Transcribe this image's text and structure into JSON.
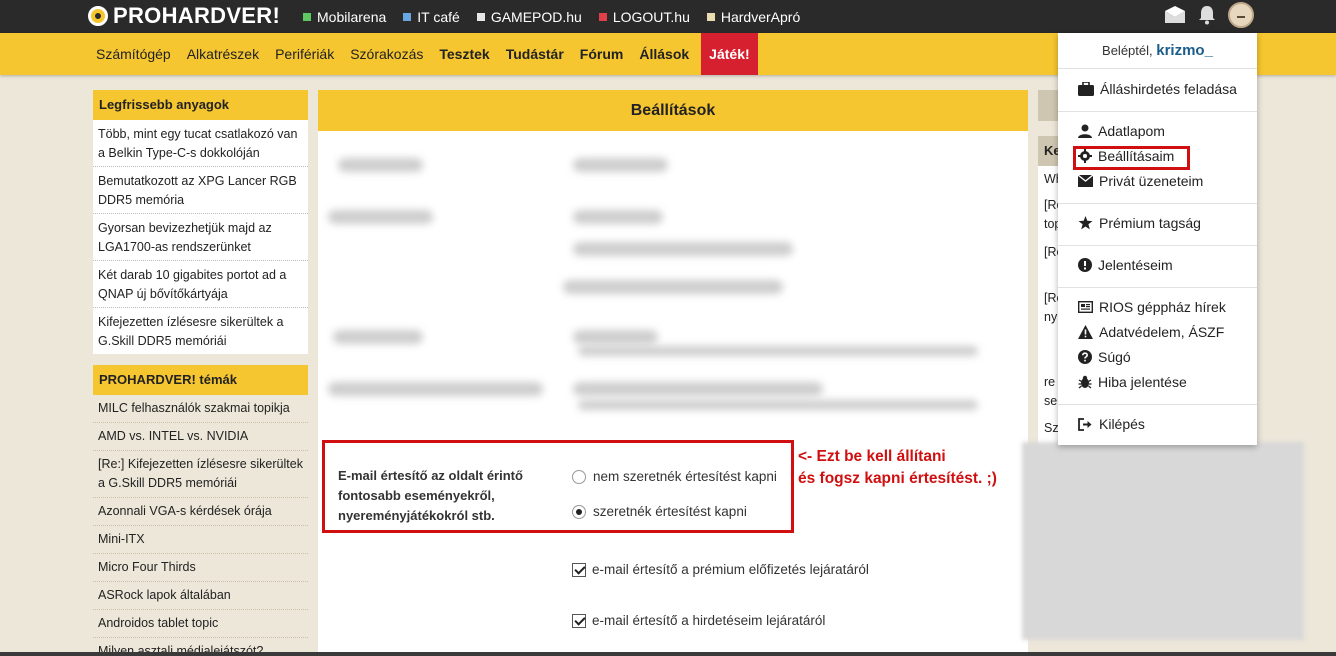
{
  "logo": {
    "text": "PROHARDVER!"
  },
  "sites": [
    {
      "label": "Mobilarena",
      "color": "#5fc75f"
    },
    {
      "label": "IT café",
      "color": "#6aa7e0"
    },
    {
      "label": "GAMEPOD.hu",
      "color": "#e6e6e6"
    },
    {
      "label": "LOGOUT.hu",
      "color": "#e0404a"
    },
    {
      "label": "HardverApró",
      "color": "#e8dcb0"
    }
  ],
  "nav": [
    {
      "label": "Számítógép"
    },
    {
      "label": "Alkatrészek"
    },
    {
      "label": "Perifériák"
    },
    {
      "label": "Szórakozás"
    },
    {
      "label": "Tesztek"
    },
    {
      "label": "Tudástár"
    },
    {
      "label": "Fórum"
    },
    {
      "label": "Állások"
    },
    {
      "label": "Játék!"
    }
  ],
  "latest": {
    "title": "Legfrissebb anyagok",
    "items": [
      "Több, mint egy tucat csatlakozó van a Belkin Type-C-s dokkolóján",
      "Bemutatkozott az XPG Lancer RGB DDR5 memória",
      "Gyorsan bevizezhetjük majd az LGA1700-as rendszerünket",
      "Két darab 10 gigabites portot ad a QNAP új bővítőkártyája",
      "Kifejezetten ízlésesre sikerültek a G.Skill DDR5 memóriái"
    ]
  },
  "topics": {
    "title": "PROHARDVER! témák",
    "items": [
      "MILC felhasználók szakmai topikja",
      "AMD vs. INTEL vs. NVIDIA",
      "[Re:] Kifejezetten ízlésesre sikerültek a G.Skill DDR5 memóriái",
      "Azonnali VGA-s kérdések órája",
      "Mini-ITX",
      "Micro Four Thirds",
      "ASRock lapok általában",
      "Androidos tablet topic",
      "Milyen asztali médialejátszót?"
    ]
  },
  "settings": {
    "title": "Beállítások",
    "email_label": "E-mail értesítő az oldalt érintő fontosabb eseményekről, nyereményjátékokról stb.",
    "radio_no": "nem szeretnék értesítést kapni",
    "radio_yes": "szeretnék értesítést kapni",
    "check_premium": "e-mail értesítő a prémium előfizetés lejáratáról",
    "check_ads": "e-mail értesítő a hirdetéseim lejáratáról"
  },
  "annotation": {
    "line1": "<- Ezt be kell állítani",
    "line2": "és fogsz kapni értesítést. ;)"
  },
  "right": {
    "head": "Ke",
    "lines": [
      "Wh",
      "[Re",
      "top",
      "[Re",
      "[Re",
      "ny",
      "re",
      "se",
      "se",
      "Sz"
    ]
  },
  "dropdown": {
    "logged_prefix": "Beléptél,",
    "username": "krizmo_",
    "items": {
      "jobpost": "Álláshirdetés feladása",
      "profile": "Adatlapom",
      "settings": "Beállításaim",
      "messages": "Privát üzeneteim",
      "premium": "Prémium tagság",
      "reports": "Jelentéseim",
      "rios": "RIOS géppház hírek",
      "privacy": "Adatvédelem, ÁSZF",
      "help": "Súgó",
      "bug": "Hiba jelentése",
      "logout": "Kilépés"
    }
  }
}
